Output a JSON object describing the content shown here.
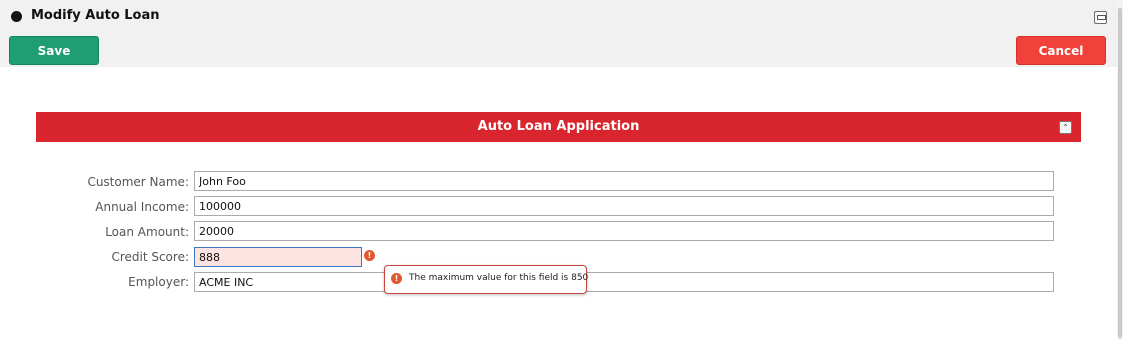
{
  "header": {
    "title": "Modify Auto Loan",
    "save_label": "Save",
    "cancel_label": "Cancel"
  },
  "section": {
    "title": "Auto Loan Application"
  },
  "form": {
    "customer_name": {
      "label": "Customer Name:",
      "value": "John Foo"
    },
    "annual_income": {
      "label": "Annual Income:",
      "value": "100000"
    },
    "loan_amount": {
      "label": "Loan Amount:",
      "value": "20000"
    },
    "credit_score": {
      "label": "Credit Score:",
      "value": "888"
    },
    "employer": {
      "label": "Employer:",
      "value": "ACME INC"
    }
  },
  "validation": {
    "credit_score_error": "The maximum value for this field is 850"
  },
  "icons": {
    "bullet": "bullet-icon",
    "restore": "restore-window-icon",
    "collapse": "collapse-section-icon",
    "error": "error-icon"
  },
  "colors": {
    "save": "#1f9e73",
    "cancel": "#f0413b",
    "section_header": "#d9262e",
    "error_field_bg": "#fde3e1",
    "error_icon": "#e4572e"
  }
}
